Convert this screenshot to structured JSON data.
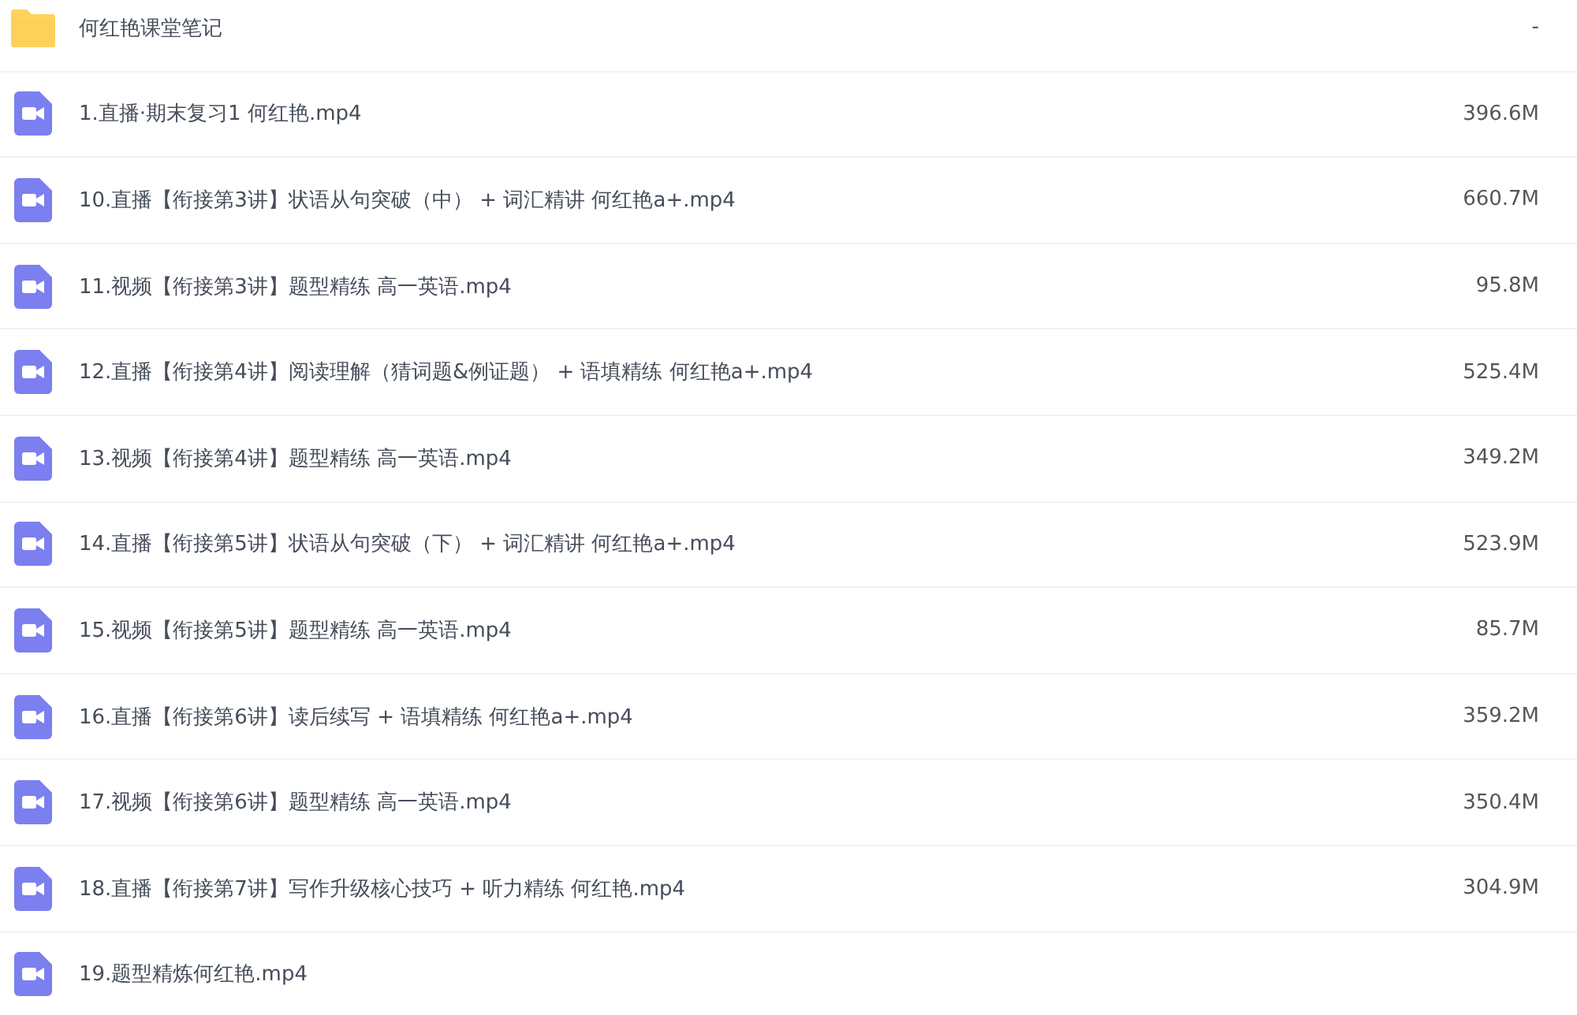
{
  "files": [
    {
      "kind": "folder",
      "name": "何红艳课堂笔记",
      "size": "-"
    },
    {
      "kind": "video",
      "name": "1.直播·期末复习1 何红艳.mp4",
      "size": "396.6M"
    },
    {
      "kind": "video",
      "name": "10.直播【衔接第3讲】状语从句突破（中） + 词汇精讲 何红艳a+.mp4",
      "size": "660.7M"
    },
    {
      "kind": "video",
      "name": "11.视频【衔接第3讲】题型精练 高一英语.mp4",
      "size": "95.8M"
    },
    {
      "kind": "video",
      "name": "12.直播【衔接第4讲】阅读理解（猜词题&例证题） + 语填精练 何红艳a+.mp4",
      "size": "525.4M"
    },
    {
      "kind": "video",
      "name": "13.视频【衔接第4讲】题型精练 高一英语.mp4",
      "size": "349.2M"
    },
    {
      "kind": "video",
      "name": "14.直播【衔接第5讲】状语从句突破（下） + 词汇精讲 何红艳a+.mp4",
      "size": "523.9M"
    },
    {
      "kind": "video",
      "name": "15.视频【衔接第5讲】题型精练 高一英语.mp4",
      "size": "85.7M"
    },
    {
      "kind": "video",
      "name": "16.直播【衔接第6讲】读后续写 + 语填精练 何红艳a+.mp4",
      "size": "359.2M"
    },
    {
      "kind": "video",
      "name": "17.视频【衔接第6讲】题型精练 高一英语.mp4",
      "size": "350.4M"
    },
    {
      "kind": "video",
      "name": "18.直播【衔接第7讲】写作升级核心技巧 + 听力精练 何红艳.mp4",
      "size": "304.9M"
    },
    {
      "kind": "video",
      "name": "19.题型精炼何红艳.mp4"
    }
  ]
}
